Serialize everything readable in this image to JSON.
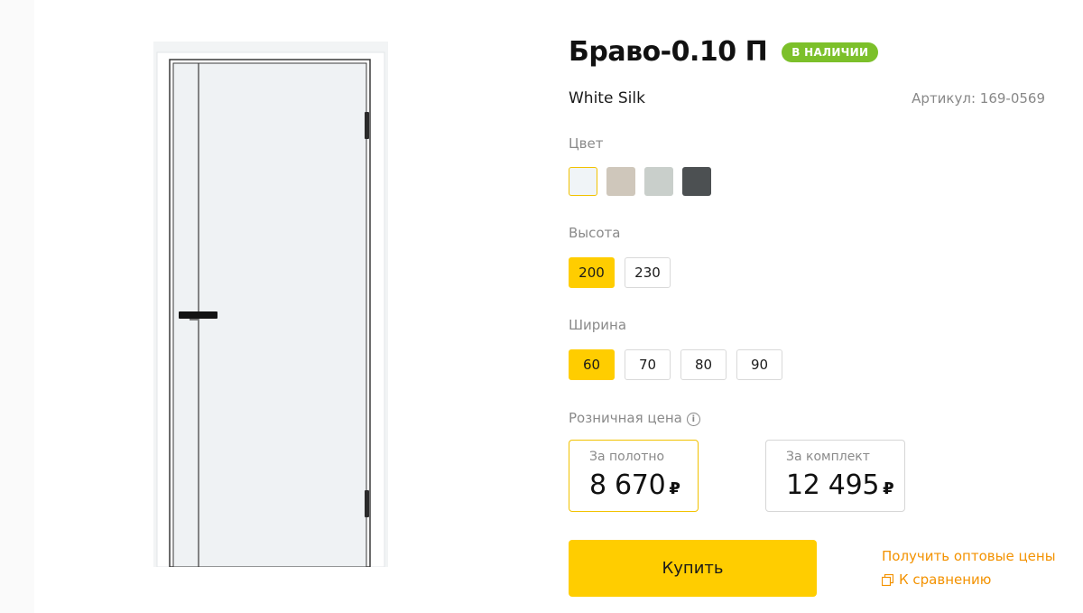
{
  "product": {
    "title": "Браво-0.10 П",
    "stock_badge": "В НАЛИЧИИ",
    "finish": "White Silk",
    "sku": "Артикул: 169-0569"
  },
  "color": {
    "label": "Цвет",
    "swatches": [
      {
        "name": "white",
        "hex": "#f0f4f7",
        "selected": true
      },
      {
        "name": "beige",
        "hex": "#cfc7bb",
        "selected": false
      },
      {
        "name": "light-grey",
        "hex": "#c9cfcb",
        "selected": false
      },
      {
        "name": "anthracite",
        "hex": "#4c5052",
        "selected": false
      }
    ]
  },
  "height": {
    "label": "Высота",
    "options": [
      {
        "value": "200",
        "selected": true
      },
      {
        "value": "230",
        "selected": false
      }
    ]
  },
  "width": {
    "label": "Ширина",
    "options": [
      {
        "value": "60",
        "selected": true
      },
      {
        "value": "70",
        "selected": false
      },
      {
        "value": "80",
        "selected": false
      },
      {
        "value": "90",
        "selected": false
      }
    ]
  },
  "price": {
    "label": "Розничная цена",
    "info_icon": "info-icon",
    "leaf": {
      "caption": "За полотно",
      "value": "8 670",
      "currency": "₽"
    },
    "set": {
      "caption": "За комплект",
      "value": "12 495",
      "currency": "₽"
    }
  },
  "actions": {
    "buy_label": "Купить",
    "wholesale_link": "Получить оптовые цены",
    "compare_link": "К сравнению",
    "compare_icon": "compare-icon"
  },
  "colors": {
    "accent": "#ffcd00",
    "badge_green": "#7cc02a",
    "link_orange": "#f39200",
    "label_grey": "#8a8a8a"
  }
}
